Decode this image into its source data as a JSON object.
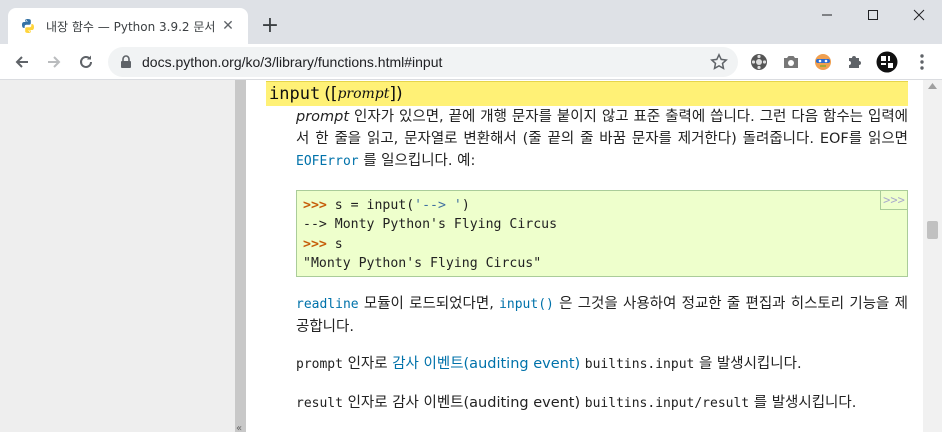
{
  "tab": {
    "title": "내장 함수 — Python 3.9.2 문서",
    "close_glyph": "✕"
  },
  "toolbar": {
    "url": "docs.python.org/ko/3/library/functions.html#input",
    "new_tab_glyph": "+"
  },
  "signature": {
    "name": "input",
    "open": "([",
    "arg": "prompt",
    "close": "])"
  },
  "para1": {
    "arg": "prompt",
    "text1": " 인자가 있으면, 끝에 개행 문자를 붙이지 않고 표준 출력에 씁니다. 그런 다음 함수는 입력에서 한 줄을 읽고, 문자열로 변환해서 (줄 끝의 줄 바꿈 문자를 제거한다) 돌려줍니다. EOF를 읽으면 ",
    "exc": "EOFError",
    "text2": " 를 일으킵니다. 예:"
  },
  "code_example": {
    "copy_label": ">>>",
    "line1_prompt": ">>> ",
    "line1_a": "s = input(",
    "line1_str": "'--> '",
    "line1_b": ")",
    "line2": "--> Monty Python's Flying Circus",
    "line3_prompt": ">>> ",
    "line3_code": "s",
    "line4": "\"Monty Python's Flying Circus\""
  },
  "para2": {
    "module": "readline",
    "text1": " 모듈이 로드되었다면, ",
    "func": "input()",
    "text2": " 은 그것을 사용하여 정교한 줄 편집과 히스토리 기능을 제공합니다."
  },
  "para3": {
    "code1": "prompt",
    "text1": " 인자로 ",
    "link": "감사 이벤트(auditing event)",
    "text2": " ",
    "code2": "builtins.input",
    "text3": " 을 발생시킵니다."
  },
  "para4": {
    "code1": "result",
    "text1": " 인자로 감사 이벤트(auditing event) ",
    "code2": "builtins.input/result",
    "text2": " 를 발생시킵니다."
  },
  "colors": {
    "signature_bg": "#fff176",
    "code_bg": "#eeffcc",
    "link": "#0072aa",
    "sidebar_bg": "#eeeeee"
  }
}
